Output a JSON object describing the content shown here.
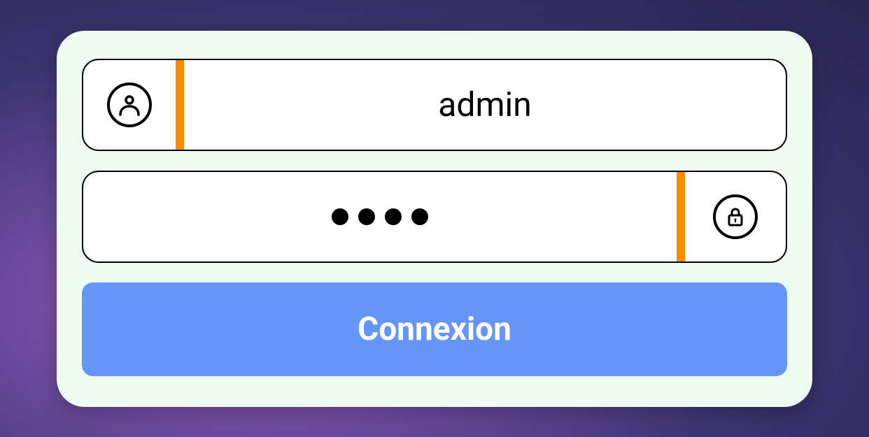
{
  "login": {
    "username_value": "admin",
    "password_mask_length": 4,
    "submit_label": "Connexion"
  },
  "colors": {
    "accent": "#ff8c00",
    "button": "#6495f7",
    "card_bg": "#eefbf0"
  }
}
